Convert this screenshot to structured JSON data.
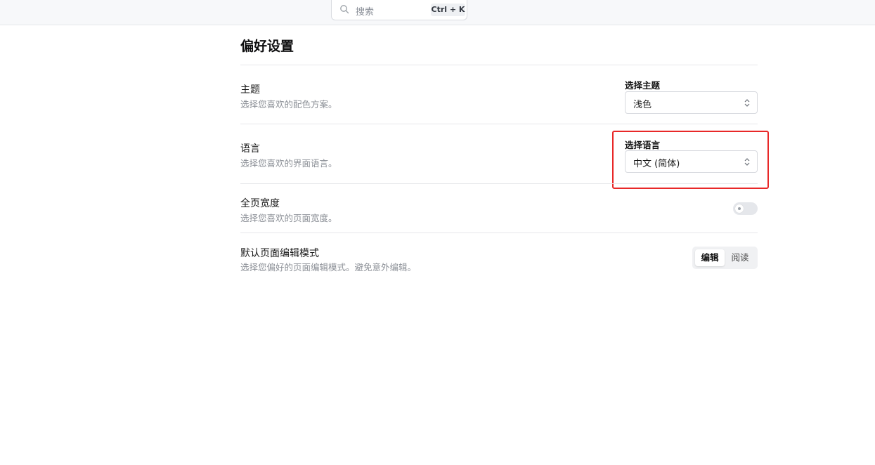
{
  "search": {
    "placeholder": "搜索",
    "shortcut": "Ctrl + K"
  },
  "page": {
    "title": "偏好设置"
  },
  "rows": {
    "theme": {
      "title": "主题",
      "description": "选择您喜欢的配色方案。",
      "field_label": "选择主题",
      "value": "浅色"
    },
    "language": {
      "title": "语言",
      "description": "选择您喜欢的界面语言。",
      "field_label": "选择语言",
      "value": "中文 (简体)"
    },
    "full_width": {
      "title": "全页宽度",
      "description": "选择您喜欢的页面宽度。",
      "enabled": false
    },
    "edit_mode": {
      "title": "默认页面编辑模式",
      "description": "选择您偏好的页面编辑模式。避免意外编辑。",
      "options": [
        "编辑",
        "阅读"
      ],
      "selected": "编辑"
    }
  },
  "colors": {
    "highlight": "#e82828",
    "divider": "#e6e7ea",
    "muted_text": "#8b8f96"
  },
  "icons": {
    "search": "search-icon",
    "select_chevron": "chevron-up-down-icon"
  }
}
